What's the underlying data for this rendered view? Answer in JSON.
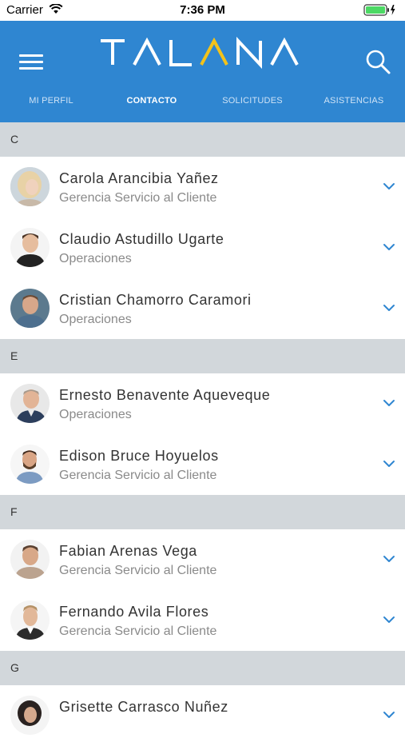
{
  "status": {
    "carrier": "Carrier",
    "time": "7:36 PM"
  },
  "header": {
    "logo_text": "TALANA",
    "brand_color": "#2f86d1",
    "accent_color": "#f3c21a"
  },
  "tabs": [
    {
      "label": "MI PERFIL"
    },
    {
      "label": "CONTACTO"
    },
    {
      "label": "SOLICITUDES"
    },
    {
      "label": "ASISTENCIAS"
    }
  ],
  "active_tab": "CONTACTO",
  "sections": [
    {
      "letter": "C",
      "contacts": [
        {
          "name": "Carola Arancibia Yañez",
          "department": "Gerencia Servicio al Cliente"
        },
        {
          "name": "Claudio Astudillo Ugarte",
          "department": "Operaciones"
        },
        {
          "name": "Cristian Chamorro Caramori",
          "department": "Operaciones"
        }
      ]
    },
    {
      "letter": "E",
      "contacts": [
        {
          "name": "Ernesto Benavente Aqueveque",
          "department": "Operaciones"
        },
        {
          "name": "Edison Bruce Hoyuelos",
          "department": "Gerencia Servicio al Cliente"
        }
      ]
    },
    {
      "letter": "F",
      "contacts": [
        {
          "name": "Fabian Arenas Vega",
          "department": "Gerencia Servicio al Cliente"
        },
        {
          "name": "Fernando Avila Flores",
          "department": "Gerencia Servicio al Cliente"
        }
      ]
    },
    {
      "letter": "G",
      "contacts": [
        {
          "name": "Grisette Carrasco Nuñez",
          "department": ""
        }
      ]
    }
  ]
}
